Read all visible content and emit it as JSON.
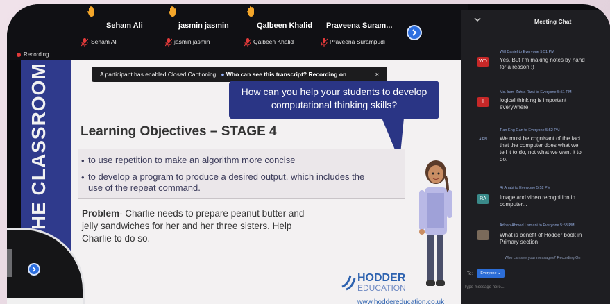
{
  "participants": [
    {
      "name": "Seham Ali",
      "sub": "Seham Ali"
    },
    {
      "name": "jasmin jasmin",
      "sub": "jasmin jasmin"
    },
    {
      "name": "Qalbeen Khalid",
      "sub": "Qalbeen Khalid"
    },
    {
      "name": "Praveena Suram...",
      "sub": "Praveena Surampudi"
    }
  ],
  "recording_label": "Recording",
  "cc_banner": {
    "text": "A participant has enabled Closed Captioning",
    "question": "Who can see this transcript? Recording on",
    "close": "×"
  },
  "slide": {
    "sidebar_text": "HE CLASSROOM",
    "bubble_line1": "How can you help your students to develop",
    "bubble_line2": "computational thinking skills?",
    "title": "Learning Objectives – STAGE 4",
    "objectives": [
      "to use repetition to make an algorithm more concise",
      "to develop a program to produce a desired output, which includes the",
      "use of the repeat command."
    ],
    "problem_label": "Problem",
    "problem_text": "- Charlie needs to prepare peanut butter and",
    "problem_line2": "jelly sandwiches for her and her three sisters. Help",
    "problem_line3": "Charlie to do so.",
    "brand_name": "HODDER",
    "brand_sub": "EDUCATION",
    "brand_url": "www.hoddereducation.co.uk"
  },
  "chat": {
    "title": "Meeting Chat",
    "messages": [
      {
        "avatar": "WD",
        "meta": "Will Daniel to Everyone 5:51 PM",
        "line1": "Yes. But I'm making notes by hand",
        "line2": "for a reason :)"
      },
      {
        "avatar": "I",
        "meta": "Ms. Iram Zahra Rizvi to Everyone 5:51 PM",
        "line1": "logical thinking is important",
        "line2": "everywhere"
      },
      {
        "avatar": "AIEN",
        "meta": "Tian Eng Gan to Everyone 5:52 PM",
        "line1": "We must be cognisant of the fact",
        "line2": "that the computer does what we",
        "line3": "tell it to do, not what we want it to",
        "line4": "do."
      },
      {
        "avatar": "RA",
        "meta": "Rj Anabi to Everyone 5:52 PM",
        "line1": "Image and video recognition in",
        "line2": "computer..."
      },
      {
        "avatar": "",
        "meta": "Adnan Ahmed Usmani to Everyone 5:53 PM",
        "line1": "What is benefit of Hodder book in",
        "line2": "Primary section"
      }
    ],
    "note": "Who can see your messages? Recording On",
    "to_label": "To:",
    "to_value": "Everyone ⌄",
    "input_placeholder": "Type message here..."
  },
  "colors": {
    "slide_blue": "#2f3a8c",
    "accent_blue": "#2d6fe0",
    "hand_yellow": "#f4a62a",
    "avatar_red": "#c62828",
    "avatar_teal": "#3a8a8a"
  }
}
